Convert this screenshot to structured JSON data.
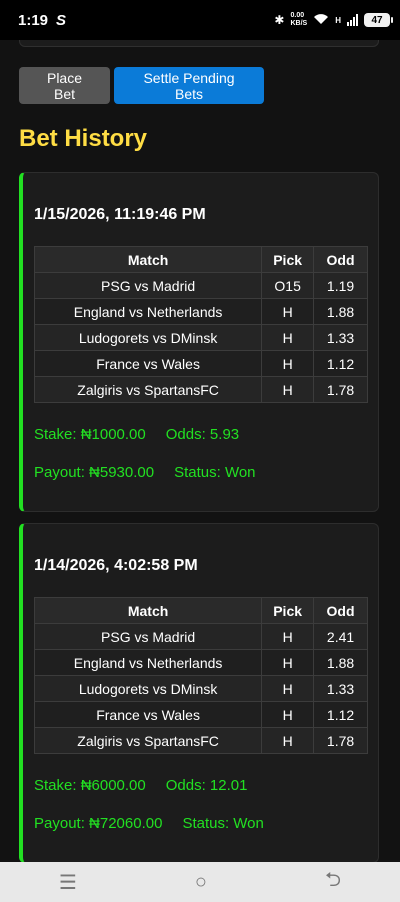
{
  "status_bar": {
    "time": "1:19",
    "carrier_icon": "S",
    "speed_value": "0.00",
    "speed_unit": "KB/S",
    "network_label": "H",
    "battery": "47"
  },
  "actions": {
    "place_bet_label": "Place Bet",
    "settle_label": "Settle Pending Bets"
  },
  "section_title": "Bet History",
  "table_headers": {
    "match": "Match",
    "pick": "Pick",
    "odd": "Odd"
  },
  "bets": [
    {
      "date": "1/15/2026, 11:19:46 PM",
      "rows": [
        {
          "match": "PSG vs Madrid",
          "pick": "O15",
          "odd": "1.19"
        },
        {
          "match": "England vs Netherlands",
          "pick": "H",
          "odd": "1.88"
        },
        {
          "match": "Ludogorets vs DMinsk",
          "pick": "H",
          "odd": "1.33"
        },
        {
          "match": "France vs Wales",
          "pick": "H",
          "odd": "1.12"
        },
        {
          "match": "Zalgiris vs SpartansFC",
          "pick": "H",
          "odd": "1.78"
        }
      ],
      "stake": "Stake: ₦1000.00",
      "odds": "Odds: 5.93",
      "payout": "Payout: ₦5930.00",
      "status": "Status: Won"
    },
    {
      "date": "1/14/2026, 4:02:58 PM",
      "rows": [
        {
          "match": "PSG vs Madrid",
          "pick": "H",
          "odd": "2.41"
        },
        {
          "match": "England vs Netherlands",
          "pick": "H",
          "odd": "1.88"
        },
        {
          "match": "Ludogorets vs DMinsk",
          "pick": "H",
          "odd": "1.33"
        },
        {
          "match": "France vs Wales",
          "pick": "H",
          "odd": "1.12"
        },
        {
          "match": "Zalgiris vs SpartansFC",
          "pick": "H",
          "odd": "1.78"
        }
      ],
      "stake": "Stake: ₦6000.00",
      "odds": "Odds: 12.01",
      "payout": "Payout: ₦72060.00",
      "status": "Status: Won"
    }
  ],
  "nav": {
    "menu_icon": "☰",
    "home_icon": "○",
    "back_icon": "⮌"
  }
}
